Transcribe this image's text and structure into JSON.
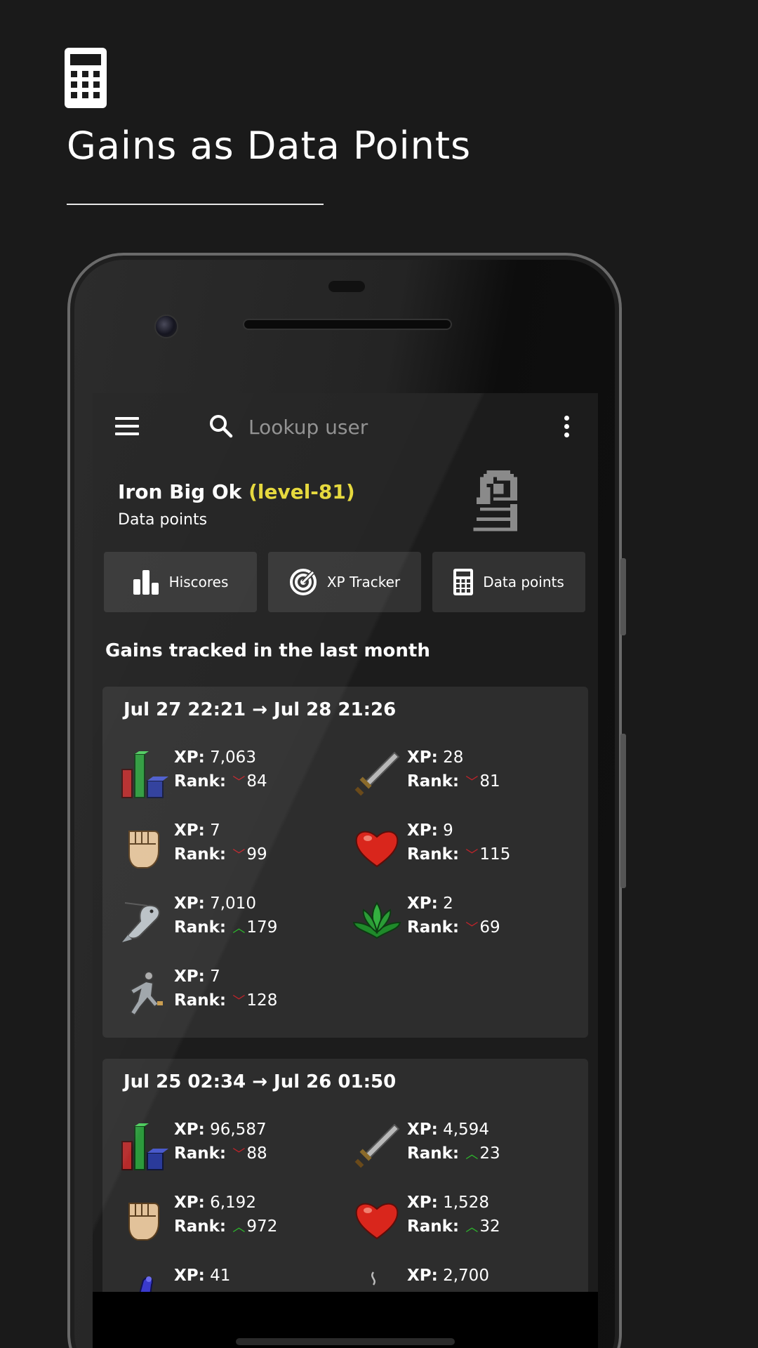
{
  "promo": {
    "title": "Gains as Data Points"
  },
  "search": {
    "placeholder": "Lookup user"
  },
  "profile": {
    "name": "Iron Big Ok",
    "level": "(level-81)",
    "subtitle": "Data points"
  },
  "nav": [
    {
      "label": "Hiscores",
      "icon": "bar-chart-icon"
    },
    {
      "label": "XP Tracker",
      "icon": "radar-icon"
    },
    {
      "label": "Data points",
      "icon": "calculator-icon"
    }
  ],
  "section_title": "Gains tracked in the last month",
  "labels": {
    "xp": "XP:",
    "rank": "Rank:"
  },
  "colors": {
    "level": "#e5d735",
    "rank_down": "#c4232a",
    "rank_up": "#2db72d",
    "card": "#2d2d2d",
    "button": "#323232"
  },
  "cards": [
    {
      "period": "Jul 27 22:21 → Jul 28 21:26",
      "stats": [
        {
          "skill_icon": "overall-icon",
          "xp": "7,063",
          "rank_dir": "down",
          "rank": "84"
        },
        {
          "skill_icon": "attack-icon",
          "xp": "28",
          "rank_dir": "down",
          "rank": "81"
        },
        {
          "skill_icon": "strength-icon",
          "xp": "7",
          "rank_dir": "down",
          "rank": "99"
        },
        {
          "skill_icon": "hitpoints-icon",
          "xp": "9",
          "rank_dir": "down",
          "rank": "115"
        },
        {
          "skill_icon": "fishing-icon",
          "xp": "7,010",
          "rank_dir": "up",
          "rank": "179"
        },
        {
          "skill_icon": "herblore-icon",
          "xp": "2",
          "rank_dir": "down",
          "rank": "69"
        },
        {
          "skill_icon": "agility-icon",
          "xp": "7",
          "rank_dir": "down",
          "rank": "128"
        }
      ]
    },
    {
      "period": "Jul 25 02:34 → Jul 26 01:50",
      "stats": [
        {
          "skill_icon": "overall-icon",
          "xp": "96,587",
          "rank_dir": "down",
          "rank": "88"
        },
        {
          "skill_icon": "attack-icon",
          "xp": "4,594",
          "rank_dir": "up",
          "rank": "23"
        },
        {
          "skill_icon": "strength-icon",
          "xp": "6,192",
          "rank_dir": "up",
          "rank": "972"
        },
        {
          "skill_icon": "hitpoints-icon",
          "xp": "1,528",
          "rank_dir": "up",
          "rank": "32"
        },
        {
          "skill_icon": "magic-icon",
          "xp": "41",
          "rank_dir": "",
          "rank": ""
        },
        {
          "skill_icon": "cooking-icon",
          "xp": "2,700",
          "rank_dir": "",
          "rank": ""
        }
      ]
    }
  ]
}
